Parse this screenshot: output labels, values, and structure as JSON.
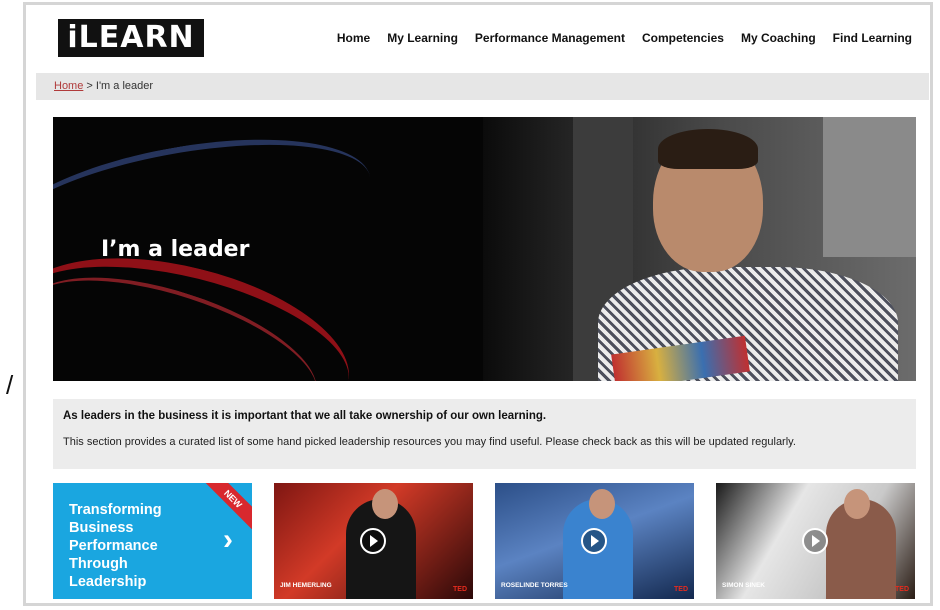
{
  "brand": {
    "logo_text": "iLEARN",
    "accent": "#e8262b"
  },
  "nav": {
    "items": [
      "Home",
      "My Learning",
      "Performance Management",
      "Competencies",
      "My Coaching",
      "Find Learning"
    ]
  },
  "breadcrumb": {
    "home": "Home",
    "separator": " > ",
    "current": "I'm a leader"
  },
  "hero": {
    "title": "I’m a leader"
  },
  "intro": {
    "lead": "As leaders in the business it is important that we all take ownership of our own learning.",
    "description": "This section provides a curated list of some hand picked leadership resources you may find useful. Please check back as this will be updated regularly."
  },
  "promo": {
    "title": "Transforming Business Performance Through Leadership",
    "badge": "NEW",
    "color": "#1aa6e0",
    "icon": "chevron-right-icon"
  },
  "videos": [
    {
      "speaker": "JIM HEMERLING",
      "badge": "TED"
    },
    {
      "speaker": "ROSELINDE TORRES",
      "badge": "TED"
    },
    {
      "speaker": "SIMON SINEK",
      "badge": "TED"
    }
  ]
}
